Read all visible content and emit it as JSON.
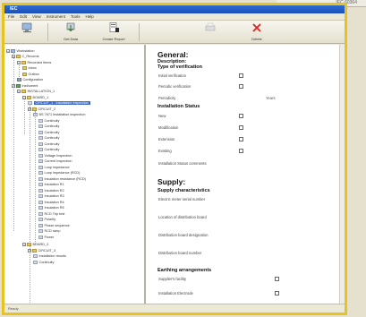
{
  "window": {
    "title": "IEC"
  },
  "backdrop": {
    "strip_text": "IEC 60364"
  },
  "menu": [
    "File",
    "Edit",
    "View",
    "Instrument",
    "Tools",
    "Help"
  ],
  "toolbar": {
    "buttons": [
      {
        "label": "",
        "icon": "computer-icon"
      },
      {
        "label": "Get Data",
        "icon": "download-icon"
      },
      {
        "label": "Create Report",
        "icon": "report-icon"
      },
      {
        "label": "",
        "icon": "printer-icon"
      },
      {
        "label": "Delete",
        "icon": "delete-icon"
      }
    ]
  },
  "tree": {
    "nodes": [
      {
        "label": "Workstation",
        "icon": "computer-icon"
      },
      {
        "label": "C_Records",
        "icon": "folder-icon"
      },
      {
        "label": "Recorded Items",
        "icon": "folder-icon"
      },
      {
        "label": "Inbox",
        "icon": "folder-icon"
      },
      {
        "label": "Outbox",
        "icon": "folder-icon"
      },
      {
        "label": "Configuration",
        "icon": "gear-icon"
      },
      {
        "label": "Instrument",
        "icon": "meter-icon"
      },
      {
        "label": "INSTALLATION_1",
        "icon": "folder-icon"
      },
      {
        "label": "BOARD_1",
        "icon": "folder-icon"
      },
      {
        "label": "CIRCUIT_1 - Installation inspection",
        "icon": "doc-icon"
      },
      {
        "label": "CIRCUIT_2",
        "icon": "folder-icon"
      },
      {
        "label": "BS 7671 Installation inspection",
        "icon": "doc-icon"
      },
      {
        "label": "Continuity",
        "icon": "doc-icon"
      },
      {
        "label": "Continuity",
        "icon": "doc-icon"
      },
      {
        "label": "Continuity",
        "icon": "doc-icon"
      },
      {
        "label": "Continuity",
        "icon": "doc-icon"
      },
      {
        "label": "Continuity",
        "icon": "doc-icon"
      },
      {
        "label": "Continuity",
        "icon": "doc-icon"
      },
      {
        "label": "Voltage Inspection",
        "icon": "doc-icon"
      },
      {
        "label": "Current Inspection",
        "icon": "doc-icon"
      },
      {
        "label": "Loop impedance",
        "icon": "doc-icon"
      },
      {
        "label": "Loop impedance (RCD)",
        "icon": "doc-icon"
      },
      {
        "label": "Insulation resistance (RCD)",
        "icon": "doc-icon"
      },
      {
        "label": "Insulation R1",
        "icon": "doc-icon"
      },
      {
        "label": "Insulation R2",
        "icon": "doc-icon"
      },
      {
        "label": "Insulation R3",
        "icon": "doc-icon"
      },
      {
        "label": "Insulation R4",
        "icon": "doc-icon"
      },
      {
        "label": "Insulation R5",
        "icon": "doc-icon"
      },
      {
        "label": "RCD Trip test",
        "icon": "doc-icon"
      },
      {
        "label": "Polarity",
        "icon": "doc-icon"
      },
      {
        "label": "Phase sequence",
        "icon": "doc-icon"
      },
      {
        "label": "RCD ramp",
        "icon": "doc-icon"
      },
      {
        "label": "Power",
        "icon": "doc-icon"
      },
      {
        "label": "BOARD_2",
        "icon": "folder-icon"
      },
      {
        "label": "CIRCUIT_3",
        "icon": "folder-icon"
      },
      {
        "label": "Installation results",
        "icon": "doc-icon"
      },
      {
        "label": "Continuity",
        "icon": "doc-icon"
      }
    ]
  },
  "panel": {
    "general_title": "General:",
    "description_label": "Description:",
    "type_label": "Type of verification",
    "type_rows": [
      {
        "label": "Initial verification"
      },
      {
        "label": "Periodic verification"
      },
      {
        "label": "Periodicity",
        "value": "Years"
      }
    ],
    "status_label": "Installation Status",
    "status_rows": [
      {
        "label": "New"
      },
      {
        "label": "Modification"
      },
      {
        "label": "Extension"
      },
      {
        "label": "Existing"
      },
      {
        "label": "Installation Status comments"
      }
    ],
    "supply_title": "Supply:",
    "supply_char_label": "Supply characteristics",
    "supply_rows": [
      {
        "label": "Electric meter serial number"
      },
      {
        "label": "Location of distribution board"
      },
      {
        "label": "Distribution board designation"
      },
      {
        "label": "Distribution board number"
      }
    ],
    "earthing_label": "Earthing arrangements",
    "earthing_rows": [
      {
        "label": "Supplier's facility"
      },
      {
        "label": "Installation Electrode"
      }
    ]
  },
  "status": {
    "text": "Ready"
  },
  "colors": {
    "accent": "#e8c320",
    "titlebar": "#1f57c3",
    "selection": "#3d6bc6"
  }
}
